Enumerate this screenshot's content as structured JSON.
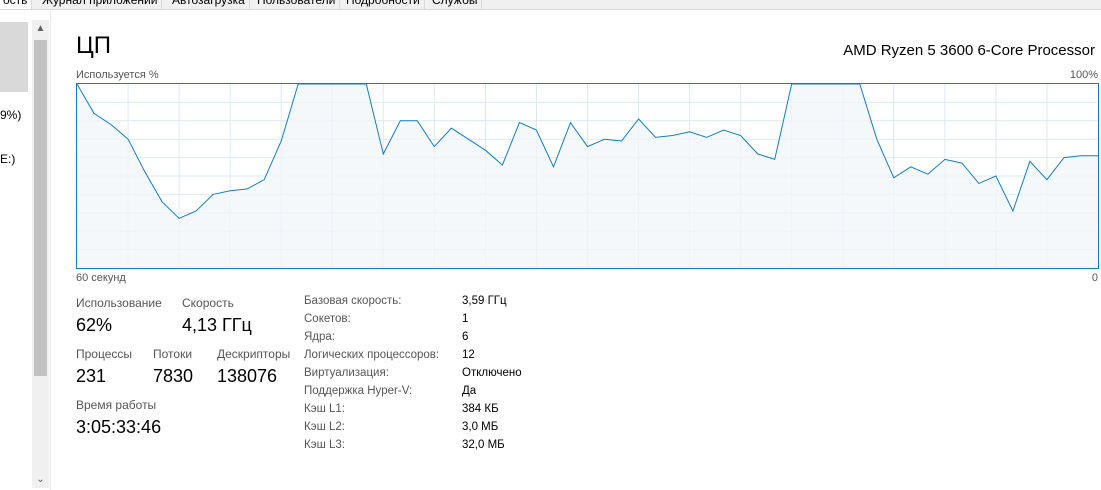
{
  "tabs": [
    {
      "label": "ость",
      "active": true
    },
    {
      "label": "Журнал приложений",
      "active": false
    },
    {
      "label": "Автозагрузка",
      "active": false
    },
    {
      "label": "Пользователи",
      "active": false
    },
    {
      "label": "Подробности",
      "active": false
    },
    {
      "label": "Службы",
      "active": false
    }
  ],
  "left_panel": {
    "items": [
      "9%)",
      "E:)"
    ]
  },
  "header": {
    "title": "ЦП",
    "cpu_model": "AMD Ryzen 5 3600 6-Core Processor"
  },
  "graph": {
    "y_label": "Используется %",
    "y_max_label": "100%",
    "x_left_label": "60 секунд",
    "x_right_label": "0",
    "line_color": "#117dbb",
    "fill_color": "#f1f6fa",
    "grid_color": "#d9eaf4"
  },
  "chart_data": {
    "type": "area",
    "x": [
      60,
      59,
      58,
      57,
      56,
      55,
      54,
      53,
      52,
      51,
      50,
      49,
      48,
      47,
      46,
      45,
      44,
      43,
      42,
      41,
      40,
      39,
      38,
      37,
      36,
      35,
      34,
      33,
      32,
      31,
      30,
      29,
      28,
      27,
      26,
      25,
      24,
      23,
      22,
      21,
      20,
      19,
      18,
      17,
      16,
      15,
      14,
      13,
      12,
      11,
      10,
      9,
      8,
      7,
      6,
      5,
      4,
      3,
      2,
      1,
      0
    ],
    "values": [
      100,
      84,
      78,
      70,
      52,
      36,
      27,
      31,
      40,
      42,
      43,
      48,
      69,
      100,
      100,
      100,
      100,
      100,
      62,
      80,
      80,
      66,
      76,
      70,
      64,
      56,
      79,
      75,
      55,
      79,
      66,
      70,
      69,
      81,
      71,
      72,
      74,
      71,
      75,
      72,
      62,
      59,
      100,
      100,
      100,
      100,
      100,
      70,
      49,
      55,
      51,
      59,
      57,
      46,
      50,
      31,
      58,
      48,
      60,
      61,
      61
    ],
    "ylim": [
      0,
      100
    ],
    "xlim": [
      60,
      0
    ],
    "grid": true
  },
  "stats": {
    "usage_label": "Использование",
    "usage_value": "62%",
    "speed_label": "Скорость",
    "speed_value": "4,13 ГГц",
    "processes_label": "Процессы",
    "processes_value": "231",
    "threads_label": "Потоки",
    "threads_value": "7830",
    "handles_label": "Дескрипторы",
    "handles_value": "138076",
    "uptime_label": "Время работы",
    "uptime_value": "3:05:33:46"
  },
  "specs": [
    {
      "label": "Базовая скорость:",
      "value": "3,59 ГГц"
    },
    {
      "label": "Сокетов:",
      "value": "1"
    },
    {
      "label": "Ядра:",
      "value": "6"
    },
    {
      "label": "Логических процессоров:",
      "value": "12"
    },
    {
      "label": "Виртуализация:",
      "value": "Отключено"
    },
    {
      "label": "Поддержка Hyper-V:",
      "value": "Да"
    },
    {
      "label": "Кэш L1:",
      "value": "384 КБ"
    },
    {
      "label": "Кэш L2:",
      "value": "3,0 МБ"
    },
    {
      "label": "Кэш L3:",
      "value": "32,0 МБ"
    }
  ]
}
